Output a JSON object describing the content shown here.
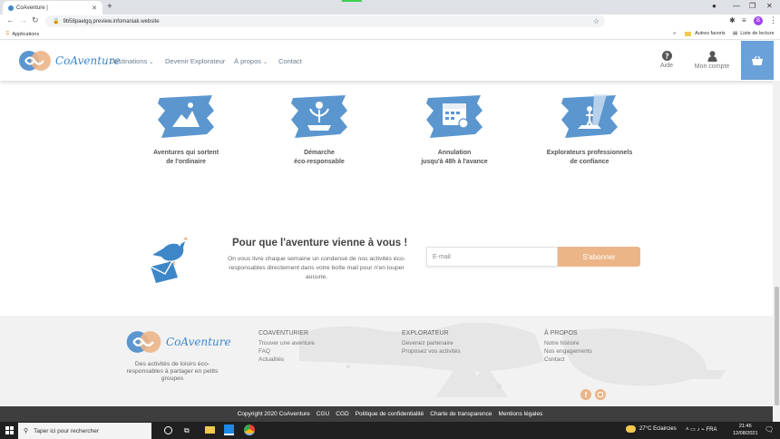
{
  "browser": {
    "tab_title": "CoAventure |",
    "url": "9b58paelgq.preview.infomaniak.website",
    "apps_label": "Applications",
    "other_favorites": "Autres favoris",
    "reading_list": "Liste de lecture",
    "profile_initial": "B"
  },
  "header": {
    "logo_text": "CoAventure",
    "nav": [
      {
        "label": "Destinations",
        "has_dropdown": true
      },
      {
        "label": "Devenir Explorateur",
        "has_dropdown": false
      },
      {
        "label": "À propos",
        "has_dropdown": true
      },
      {
        "label": "Contact",
        "has_dropdown": false
      }
    ],
    "help_label": "Aide",
    "account_label": "Mon compte"
  },
  "features": [
    {
      "line1": "Aventures qui sortent",
      "line2": "de l'ordinaire",
      "icon": "adventure-icon"
    },
    {
      "line1": "Démarche",
      "line2": "éco-responsable",
      "icon": "eco-plant-icon"
    },
    {
      "line1": "Annulation",
      "line2": "jusqu'à 48h à l'avance",
      "icon": "calendar-icon"
    },
    {
      "line1": "Explorateurs professionnels",
      "line2": "de confiance",
      "icon": "explorer-icon"
    }
  ],
  "newsletter": {
    "title": "Pour que l'aventure vienne à vous !",
    "description": "On vous livre chaque semaine un condensé de nos activités éco-responsables directement dans votre boîte mail pour n'en louper aucune.",
    "email_placeholder": "E-mail",
    "subscribe_label": "S'abonner"
  },
  "footer": {
    "logo_text": "CoAventure",
    "tagline": "Des activités de loisirs éco-responsables à partager en petits groupes",
    "columns": [
      {
        "heading": "COAVENTURIER",
        "links": [
          "Trouver une aventure",
          "FAQ",
          "Actualités"
        ]
      },
      {
        "heading": "EXPLORATEUR",
        "links": [
          "Devenez partenaire",
          "Proposez vos activités"
        ]
      },
      {
        "heading": "À PROPOS",
        "links": [
          "Notre histoire",
          "Nos engagements",
          "Contact"
        ]
      }
    ],
    "legal": [
      "Copyright 2020 CoAventure",
      "CGU",
      "CGD",
      "Politique de confidentialité",
      "Charte de transparence",
      "Mentions légales"
    ]
  },
  "taskbar": {
    "search_placeholder": "Taper ici pour rechercher",
    "weather": "27°C  Eclaircies",
    "time": "21:46",
    "date": "12/08/2021"
  },
  "colors": {
    "brand_blue": "#3d87c9",
    "brush_blue": "#5b96cf",
    "orange": "#ecb588",
    "footer_bg": "#f2f2f2",
    "copyright_bg": "#3e3e3e"
  }
}
